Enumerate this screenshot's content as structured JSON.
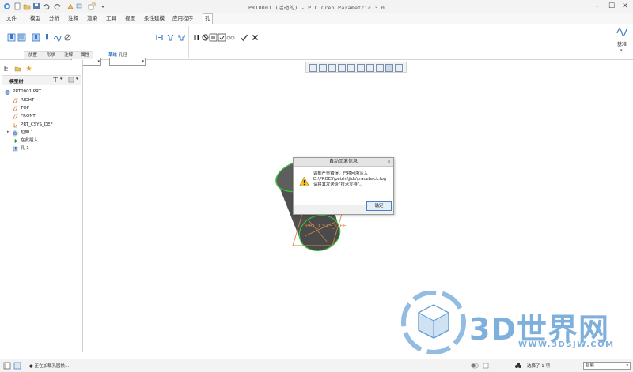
{
  "window": {
    "title": "PRT0001 (活动的) - PTC Creo Parametric 3.0"
  },
  "menu_tabs": [
    "文件",
    "模型",
    "分析",
    "注释",
    "渲染",
    "工具",
    "视图",
    "柔性建模",
    "应用程序",
    "孔"
  ],
  "ribbon": {
    "group_labels": [
      "放置",
      "形状",
      "注解",
      "属性"
    ],
    "sub_labels": [
      "草绘",
      "孔径"
    ],
    "right_label": "基准"
  },
  "model_tree": {
    "header": "模型树",
    "items": [
      {
        "label": "PRT0001.PRT",
        "icon": "part-icon"
      },
      {
        "label": "RIGHT",
        "icon": "datum-plane-icon"
      },
      {
        "label": "TOP",
        "icon": "datum-plane-icon"
      },
      {
        "label": "FRONT",
        "icon": "datum-plane-icon"
      },
      {
        "label": "PRT_CSYS_DEF",
        "icon": "csys-icon"
      },
      {
        "label": "拉伸 1",
        "icon": "extrude-icon"
      },
      {
        "label": "在此插入",
        "icon": "insert-here-icon"
      },
      {
        "label": "孔 1",
        "icon": "hole-icon"
      }
    ]
  },
  "viewport": {
    "csys_label": "PRT_CSYS_DEF"
  },
  "dialog": {
    "title": "自动回滚信息",
    "lines": [
      "遇到严重错误。已将回溯写入",
      "D:\\PROE5\\peizhi\\jide\\traceback.log",
      "请将其发送给“技术支持”。"
    ],
    "ok_label": "确定",
    "close_label": "×"
  },
  "status": {
    "message": "● 正在加载孔圆换...",
    "selection": "选择了 1 项",
    "filter": "智能"
  },
  "watermark": {
    "text": "3D世界网",
    "url": "WWW.3DSJW.COM"
  },
  "colors": {
    "accent": "#3a78c8",
    "model_body": "#555555",
    "edge_highlight": "#36c23a",
    "datum_orange": "#d08a4a",
    "watermark_blue": "#7fb0dc"
  }
}
